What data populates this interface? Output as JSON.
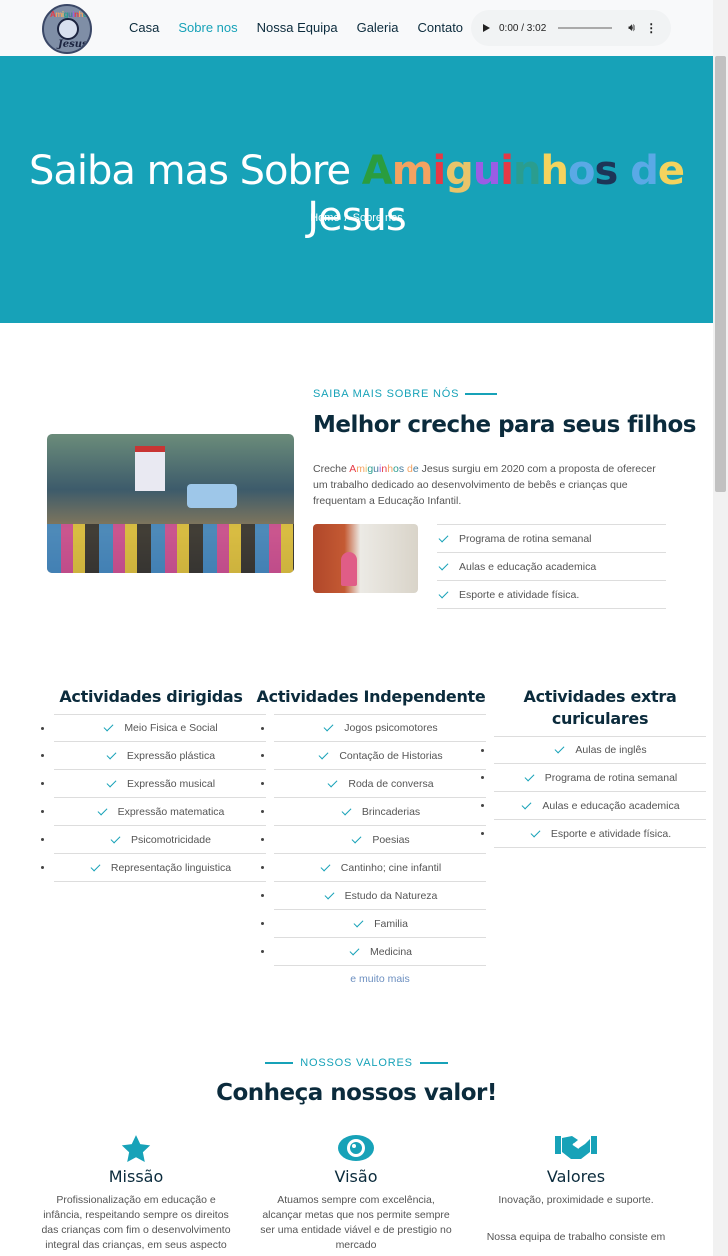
{
  "header": {
    "logo_text": "Jesus",
    "logo_caption": "Amiguinhos de",
    "nav": [
      "Casa",
      "Sobre nos",
      "Nossa Equipa",
      "Galeria",
      "Contato"
    ],
    "active_nav": "Sobre nos",
    "audio_time": "0:00 / 3:02"
  },
  "hero": {
    "title_prefix": "Saiba mas Sobre",
    "title_word1": "Amiguinhos",
    "title_word2": "de",
    "title_word3": "Jesus",
    "breadcrumb_home": "Home",
    "breadcrumb_sep": "/",
    "breadcrumb_current": "Sobre nos",
    "bg_color": "#17a2b8"
  },
  "about": {
    "eyebrow": "SAIBA MAIS SOBRE NÓS",
    "title": "Melhor creche para seus filhos",
    "text_prefix": "Creche",
    "text_name": "Amiguinhos",
    "text_de": "de",
    "text_suffix": "Jesus surgiu em 2020 com a proposta de oferecer um trabalho dedicado ao desenvolvimento de bebês e crianças que frequentam a Educação Infantil.",
    "checks": [
      "Programa de rotina semanal",
      "Aulas e educação academica",
      "Esporte e atividade física."
    ]
  },
  "activities": {
    "dirigidas": {
      "title": "Actividades dirigidas",
      "items": [
        "Meio Fisica e Social",
        "Expressão plástica",
        "Expressão musical",
        "Expressão matematica",
        "Psicomotricidade",
        "Representação linguistica"
      ]
    },
    "independente": {
      "title": "Actividades Independente",
      "items": [
        "Jogos psicomotores",
        "Contação de Historias",
        "Roda de conversa",
        "Brincaderias",
        "Poesias",
        "Cantinho; cine infantil",
        "Estudo da Natureza",
        "Familia",
        "Medicina"
      ],
      "more": "e muito mais"
    },
    "extra": {
      "title": "Actividades extra curiculares",
      "items": [
        "Aulas de inglês",
        "Programa de rotina semanal",
        "Aulas e educação academica",
        "Esporte e atividade física."
      ]
    }
  },
  "valores": {
    "eyebrow": "NOSSOS VALORES",
    "title": "Conheça nossos valor!",
    "missao": {
      "icon": "star-icon",
      "title": "Missão",
      "text": "Profissionalização em educação e infância, respeitando sempre os direitos das crianças com fim o desenvolvimento integral das crianças, em seus aspecto"
    },
    "visao": {
      "icon": "eye-icon",
      "title": "Visão",
      "text": "Atuamos sempre com excelência, alcançar metas que nos permite sempre ser uma entidade viável e de prestigio no mercado"
    },
    "valores": {
      "icon": "handshake-icon",
      "title": "Valores",
      "text": "Inovação, proximidade e suporte.",
      "text2": "Nossa equipa de trabalho consiste em"
    }
  },
  "colors": {
    "accent": "#17a2b8",
    "heading": "#0b2b3c"
  }
}
